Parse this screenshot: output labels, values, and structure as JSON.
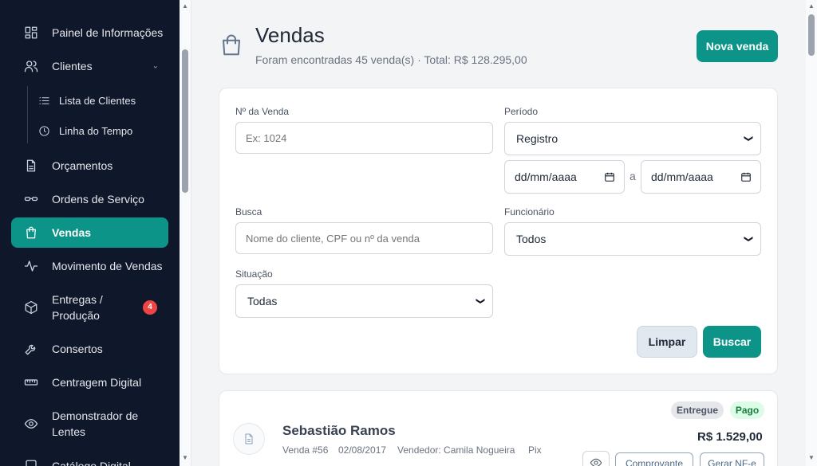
{
  "sidebar": {
    "items": [
      {
        "label": "Painel de Informações",
        "icon": "dashboard-icon"
      },
      {
        "label": "Clientes",
        "icon": "users-icon"
      },
      {
        "label": "Lista de Clientes",
        "icon": "list-icon"
      },
      {
        "label": "Linha do Tempo",
        "icon": "clock-icon"
      },
      {
        "label": "Orçamentos",
        "icon": "document-icon"
      },
      {
        "label": "Ordens de Serviço",
        "icon": "glasses-icon"
      },
      {
        "label": "Vendas",
        "icon": "shopping-bag-icon"
      },
      {
        "label": "Movimento de Vendas",
        "icon": "activity-icon"
      },
      {
        "label": "Entregas / Produção",
        "icon": "package-icon",
        "badge": "4"
      },
      {
        "label": "Consertos",
        "icon": "wrench-icon"
      },
      {
        "label": "Centragem Digital",
        "icon": "ruler-icon"
      },
      {
        "label": "Demonstrador de Lentes",
        "icon": "eye-icon"
      },
      {
        "label": "Catálogo Digital",
        "icon": "book-icon"
      }
    ]
  },
  "header": {
    "title": "Vendas",
    "subtitle": "Foram encontradas 45 venda(s) · Total: R$ 128.295,00",
    "new_button": "Nova venda"
  },
  "filters": {
    "sale_number_label": "Nº da Venda",
    "sale_number_placeholder": "Ex: 1024",
    "period_label": "Período",
    "period_value": "Registro",
    "date_from": "dd/mm/aaaa",
    "date_sep": "a",
    "date_to": "dd/mm/aaaa",
    "search_label": "Busca",
    "search_placeholder": "Nome do cliente, CPF ou nº da venda",
    "employee_label": "Funcionário",
    "employee_value": "Todos",
    "status_label": "Situação",
    "status_value": "Todas",
    "clear_button": "Limpar",
    "search_button": "Buscar"
  },
  "sales": [
    {
      "customer": "Sebastião Ramos",
      "number": "Venda #56",
      "date": "02/08/2017",
      "seller": "Vendedor: Camila Nogueira",
      "payment": "Pix",
      "delivery_status": "Entregue",
      "payment_status": "Pago",
      "total": "R$ 1.529,00",
      "receipt_button": "Comprovante",
      "nfe_button": "Gerar NF-e"
    }
  ],
  "colors": {
    "accent": "#0d9488",
    "sidebar_bg": "#0f172a",
    "badge": "#ef4444"
  }
}
